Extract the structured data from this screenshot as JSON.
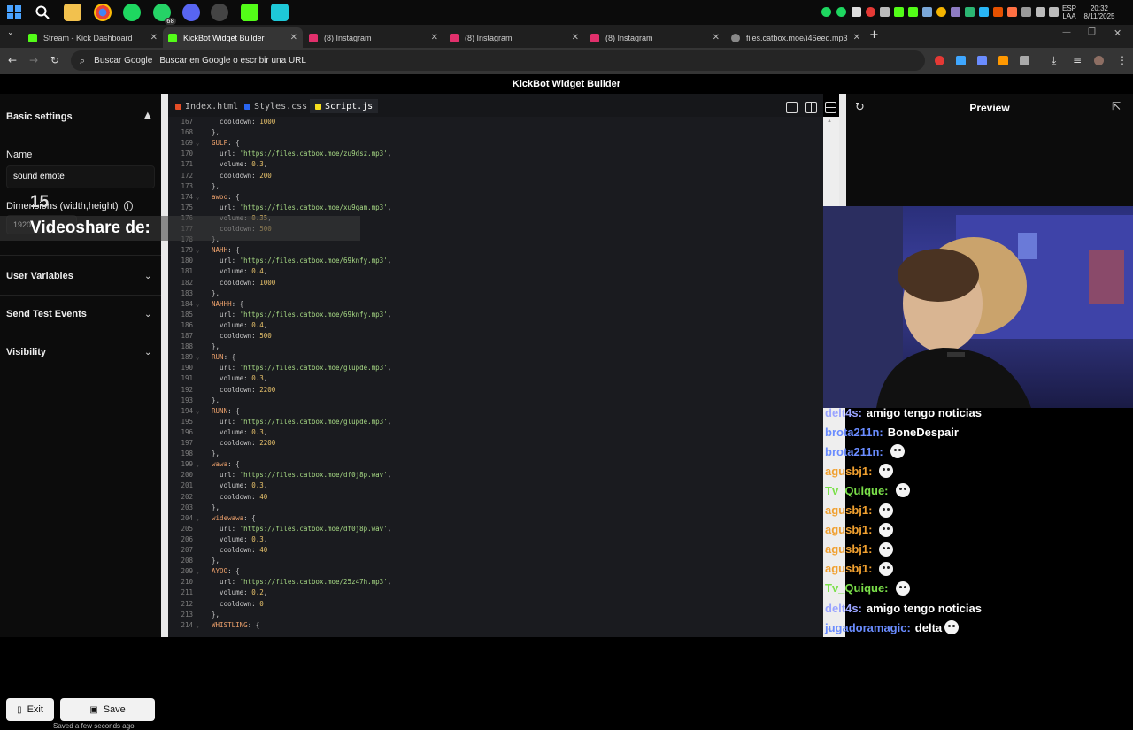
{
  "taskbar": {
    "whatsapp_badge": "68",
    "lang_top": "ESP",
    "lang_bottom": "LAA",
    "time": "20:32",
    "date": "8/11/2025"
  },
  "tabs": [
    {
      "label": "Stream - Kick Dashboard",
      "fav_color": "#53fc18"
    },
    {
      "label": "KickBot Widget Builder",
      "fav_color": "#53fc18"
    },
    {
      "label": "(8) Instagram",
      "fav_color": "#e1306c"
    },
    {
      "label": "(8) Instagram",
      "fav_color": "#e1306c"
    },
    {
      "label": "(8) Instagram",
      "fav_color": "#e1306c"
    },
    {
      "label": "files.catbox.moe/i46eeq.mp3",
      "fav_color": "#aaaaaa"
    }
  ],
  "address": {
    "prefix": "Buscar Google",
    "placeholder": "Buscar en Google o escribir una URL"
  },
  "app": {
    "title": "KickBot Widget Builder"
  },
  "sidebar": {
    "basic_settings": "Basic settings",
    "name_label": "Name",
    "name_value": "sound emote",
    "dimensions_label": "Dimensions (width,height)",
    "width_value": "1920",
    "user_variables": "User Variables",
    "send_test_events": "Send Test Events",
    "visibility": "Visibility",
    "exit": "Exit",
    "save": "Save",
    "saved_status": "Saved a few seconds ago"
  },
  "overlay": {
    "number": "15",
    "text": "Videoshare de:"
  },
  "editor": {
    "tabs": [
      "Index.html",
      "Styles.css",
      "Script.js"
    ],
    "active_tab": 2,
    "lines": [
      {
        "n": "167",
        "fold": false,
        "parts": [
          [
            "p",
            "    cooldown: "
          ],
          [
            "n",
            "1000"
          ]
        ]
      },
      {
        "n": "168",
        "fold": false,
        "parts": [
          [
            "p",
            "  },"
          ]
        ]
      },
      {
        "n": "169",
        "fold": true,
        "parts": [
          [
            "k",
            "  GULP"
          ],
          [
            "p",
            ": {"
          ]
        ]
      },
      {
        "n": "170",
        "fold": false,
        "parts": [
          [
            "p",
            "    url: "
          ],
          [
            "s",
            "'https://files.catbox.moe/zu9dsz.mp3'"
          ],
          [
            "p",
            ","
          ]
        ]
      },
      {
        "n": "171",
        "fold": false,
        "parts": [
          [
            "p",
            "    volume: "
          ],
          [
            "n",
            "0.3"
          ],
          [
            "p",
            ","
          ]
        ]
      },
      {
        "n": "172",
        "fold": false,
        "parts": [
          [
            "p",
            "    cooldown: "
          ],
          [
            "n",
            "200"
          ]
        ]
      },
      {
        "n": "173",
        "fold": false,
        "parts": [
          [
            "p",
            "  },"
          ]
        ]
      },
      {
        "n": "174",
        "fold": true,
        "parts": [
          [
            "k",
            "  awoo"
          ],
          [
            "p",
            ": {"
          ]
        ]
      },
      {
        "n": "175",
        "fold": false,
        "parts": [
          [
            "p",
            "    url: "
          ],
          [
            "s",
            "'https://files.catbox.moe/xu9qam.mp3'"
          ],
          [
            "p",
            ","
          ]
        ]
      },
      {
        "n": "176",
        "fold": false,
        "parts": [
          [
            "p",
            "    volume: "
          ],
          [
            "n",
            "0.35"
          ],
          [
            "p",
            ","
          ]
        ]
      },
      {
        "n": "177",
        "fold": false,
        "parts": [
          [
            "p",
            "    cooldown: "
          ],
          [
            "n",
            "500"
          ]
        ]
      },
      {
        "n": "178",
        "fold": false,
        "parts": [
          [
            "p",
            "  },"
          ]
        ]
      },
      {
        "n": "179",
        "fold": true,
        "parts": [
          [
            "k",
            "  NAHH"
          ],
          [
            "p",
            ": {"
          ]
        ]
      },
      {
        "n": "180",
        "fold": false,
        "parts": [
          [
            "p",
            "    url: "
          ],
          [
            "s",
            "'https://files.catbox.moe/69knfy.mp3'"
          ],
          [
            "p",
            ","
          ]
        ]
      },
      {
        "n": "181",
        "fold": false,
        "parts": [
          [
            "p",
            "    volume: "
          ],
          [
            "n",
            "0.4"
          ],
          [
            "p",
            ","
          ]
        ]
      },
      {
        "n": "182",
        "fold": false,
        "parts": [
          [
            "p",
            "    cooldown: "
          ],
          [
            "n",
            "1000"
          ]
        ]
      },
      {
        "n": "183",
        "fold": false,
        "parts": [
          [
            "p",
            "  },"
          ]
        ]
      },
      {
        "n": "184",
        "fold": true,
        "parts": [
          [
            "k",
            "  NAHHH"
          ],
          [
            "p",
            ": {"
          ]
        ]
      },
      {
        "n": "185",
        "fold": false,
        "parts": [
          [
            "p",
            "    url: "
          ],
          [
            "s",
            "'https://files.catbox.moe/69knfy.mp3'"
          ],
          [
            "p",
            ","
          ]
        ]
      },
      {
        "n": "186",
        "fold": false,
        "parts": [
          [
            "p",
            "    volume: "
          ],
          [
            "n",
            "0.4"
          ],
          [
            "p",
            ","
          ]
        ]
      },
      {
        "n": "187",
        "fold": false,
        "parts": [
          [
            "p",
            "    cooldown: "
          ],
          [
            "n",
            "500"
          ]
        ]
      },
      {
        "n": "188",
        "fold": false,
        "parts": [
          [
            "p",
            "  },"
          ]
        ]
      },
      {
        "n": "189",
        "fold": true,
        "parts": [
          [
            "k",
            "  RUN"
          ],
          [
            "p",
            ": {"
          ]
        ]
      },
      {
        "n": "190",
        "fold": false,
        "parts": [
          [
            "p",
            "    url: "
          ],
          [
            "s",
            "'https://files.catbox.moe/glupde.mp3'"
          ],
          [
            "p",
            ","
          ]
        ]
      },
      {
        "n": "191",
        "fold": false,
        "parts": [
          [
            "p",
            "    volume: "
          ],
          [
            "n",
            "0.3"
          ],
          [
            "p",
            ","
          ]
        ]
      },
      {
        "n": "192",
        "fold": false,
        "parts": [
          [
            "p",
            "    cooldown: "
          ],
          [
            "n",
            "2200"
          ]
        ]
      },
      {
        "n": "193",
        "fold": false,
        "parts": [
          [
            "p",
            "  },"
          ]
        ]
      },
      {
        "n": "194",
        "fold": true,
        "parts": [
          [
            "k",
            "  RUNN"
          ],
          [
            "p",
            ": {"
          ]
        ]
      },
      {
        "n": "195",
        "fold": false,
        "parts": [
          [
            "p",
            "    url: "
          ],
          [
            "s",
            "'https://files.catbox.moe/glupde.mp3'"
          ],
          [
            "p",
            ","
          ]
        ]
      },
      {
        "n": "196",
        "fold": false,
        "parts": [
          [
            "p",
            "    volume: "
          ],
          [
            "n",
            "0.3"
          ],
          [
            "p",
            ","
          ]
        ]
      },
      {
        "n": "197",
        "fold": false,
        "parts": [
          [
            "p",
            "    cooldown: "
          ],
          [
            "n",
            "2200"
          ]
        ]
      },
      {
        "n": "198",
        "fold": false,
        "parts": [
          [
            "p",
            "  },"
          ]
        ]
      },
      {
        "n": "199",
        "fold": true,
        "parts": [
          [
            "k",
            "  wawa"
          ],
          [
            "p",
            ": {"
          ]
        ]
      },
      {
        "n": "200",
        "fold": false,
        "parts": [
          [
            "p",
            "    url: "
          ],
          [
            "s",
            "'https://files.catbox.moe/df0j8p.wav'"
          ],
          [
            "p",
            ","
          ]
        ]
      },
      {
        "n": "201",
        "fold": false,
        "parts": [
          [
            "p",
            "    volume: "
          ],
          [
            "n",
            "0.3"
          ],
          [
            "p",
            ","
          ]
        ]
      },
      {
        "n": "202",
        "fold": false,
        "parts": [
          [
            "p",
            "    cooldown: "
          ],
          [
            "n",
            "40"
          ]
        ]
      },
      {
        "n": "203",
        "fold": false,
        "parts": [
          [
            "p",
            "  },"
          ]
        ]
      },
      {
        "n": "204",
        "fold": true,
        "parts": [
          [
            "k",
            "  widewawa"
          ],
          [
            "p",
            ": {"
          ]
        ]
      },
      {
        "n": "205",
        "fold": false,
        "parts": [
          [
            "p",
            "    url: "
          ],
          [
            "s",
            "'https://files.catbox.moe/df0j8p.wav'"
          ],
          [
            "p",
            ","
          ]
        ]
      },
      {
        "n": "206",
        "fold": false,
        "parts": [
          [
            "p",
            "    volume: "
          ],
          [
            "n",
            "0.3"
          ],
          [
            "p",
            ","
          ]
        ]
      },
      {
        "n": "207",
        "fold": false,
        "parts": [
          [
            "p",
            "    cooldown: "
          ],
          [
            "n",
            "40"
          ]
        ]
      },
      {
        "n": "208",
        "fold": false,
        "parts": [
          [
            "p",
            "  },"
          ]
        ]
      },
      {
        "n": "209",
        "fold": true,
        "parts": [
          [
            "k",
            "  AYOO"
          ],
          [
            "p",
            ": {"
          ]
        ]
      },
      {
        "n": "210",
        "fold": false,
        "parts": [
          [
            "p",
            "    url: "
          ],
          [
            "s",
            "'https://files.catbox.moe/25z47h.mp3'"
          ],
          [
            "p",
            ","
          ]
        ]
      },
      {
        "n": "211",
        "fold": false,
        "parts": [
          [
            "p",
            "    volume: "
          ],
          [
            "n",
            "0.2"
          ],
          [
            "p",
            ","
          ]
        ]
      },
      {
        "n": "212",
        "fold": false,
        "parts": [
          [
            "p",
            "    cooldown: "
          ],
          [
            "n",
            "0"
          ]
        ]
      },
      {
        "n": "213",
        "fold": false,
        "parts": [
          [
            "p",
            "  },"
          ]
        ]
      },
      {
        "n": "214",
        "fold": true,
        "parts": [
          [
            "k",
            "  WHISTLING"
          ],
          [
            "p",
            ": {"
          ]
        ]
      }
    ]
  },
  "preview": {
    "title": "Preview"
  },
  "chat": [
    {
      "user": "delt4s:",
      "color": "#9aa4ff",
      "msg": "amigo tengo noticias",
      "emote": false
    },
    {
      "user": "brota211n:",
      "color": "#6a8cff",
      "msg": "BoneDespair",
      "emote": false
    },
    {
      "user": "brota211n:",
      "color": "#6a8cff",
      "msg": "",
      "emote": true
    },
    {
      "user": "agusbj1:",
      "color": "#f0a030",
      "msg": "",
      "emote": true
    },
    {
      "user": "Tv_Quique:",
      "color": "#7be04a",
      "msg": "",
      "emote": true
    },
    {
      "user": "agusbj1:",
      "color": "#f0a030",
      "msg": "",
      "emote": true
    },
    {
      "user": "agusbj1:",
      "color": "#f0a030",
      "msg": "",
      "emote": true
    },
    {
      "user": "agusbj1:",
      "color": "#f0a030",
      "msg": "",
      "emote": true
    },
    {
      "user": "agusbj1:",
      "color": "#f0a030",
      "msg": "",
      "emote": true
    },
    {
      "user": "Tv_Quique:",
      "color": "#7be04a",
      "msg": "",
      "emote": true
    },
    {
      "user": "delt4s:",
      "color": "#9aa4ff",
      "msg": "amigo tengo noticias",
      "emote": false
    },
    {
      "user": "jugadoramagic:",
      "color": "#6a8cff",
      "msg": "delta",
      "emote": true
    }
  ]
}
